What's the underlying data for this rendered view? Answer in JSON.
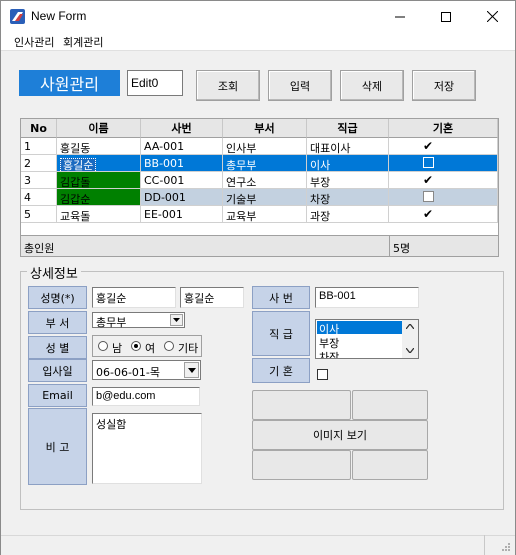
{
  "window": {
    "title": "New Form"
  },
  "menu": [
    "인사관리",
    "회계관리"
  ],
  "header": {
    "label": "사원관리",
    "edit_value": "Edit0"
  },
  "toolbar": {
    "query": "조회",
    "insert": "입력",
    "delete": "삭제",
    "save": "저장"
  },
  "grid": {
    "columns": [
      "No",
      "이름",
      "사번",
      "부서",
      "직급",
      "기혼"
    ],
    "rows": [
      {
        "no": "1",
        "name": "홍길동",
        "id": "AA-001",
        "dept": "인사부",
        "rank": "대표이사",
        "married": true
      },
      {
        "no": "2",
        "name": "홍길순",
        "id": "BB-001",
        "dept": "총무부",
        "rank": "이사",
        "married": false
      },
      {
        "no": "3",
        "name": "김갑돌",
        "id": "CC-001",
        "dept": "연구소",
        "rank": "부장",
        "married": true
      },
      {
        "no": "4",
        "name": "김갑순",
        "id": "DD-001",
        "dept": "기술부",
        "rank": "차장",
        "married": false
      },
      {
        "no": "5",
        "name": "교육돌",
        "id": "EE-001",
        "dept": "교육부",
        "rank": "과장",
        "married": true
      }
    ],
    "footer_label": "총인원",
    "footer_count": "5명",
    "selected_row": 2,
    "colors": {
      "selected": "#0078d7",
      "green_name": "#008000",
      "alt_row": "#c3d1e0"
    }
  },
  "detail": {
    "group_title": "상세정보",
    "labels": {
      "name": "성명(*)",
      "dept": "부 서",
      "gender": "성 별",
      "join": "입사일",
      "email": "Email",
      "note": "비 고",
      "emp_id": "사 번",
      "rank": "직 급",
      "married": "기 혼"
    },
    "name_value": "홍길순",
    "name_value2": "홍길순",
    "dept_value": "총무부",
    "gender_options": [
      "남",
      "여",
      "기타"
    ],
    "gender_selected": "여",
    "join_value": "06-06-01-목",
    "email_value": "b@edu.com",
    "note_value": "성실함",
    "emp_id_value": "BB-001",
    "rank_options": [
      "이사",
      "부장",
      "차장"
    ],
    "rank_selected": "이사",
    "married": false,
    "image_button": "이미지 보기"
  }
}
